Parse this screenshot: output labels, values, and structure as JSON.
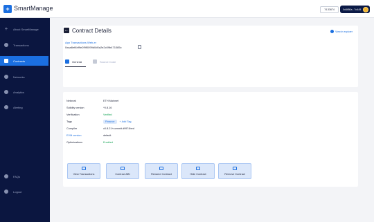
{
  "app": {
    "title": "SmartManage",
    "logo_icon": "plus-square-icon"
  },
  "header": {
    "balance": "74.33674",
    "wallet": "0x8480a...7cA45"
  },
  "sidebar": {
    "items": [
      {
        "label": "About SmartManage",
        "icon": "plus-icon"
      },
      {
        "label": "Transactions",
        "icon": "transactions-icon"
      },
      {
        "label": "Contracts",
        "icon": "contracts-icon",
        "active": true
      },
      {
        "label": "Networks",
        "icon": "networks-icon"
      },
      {
        "label": "Analytics",
        "icon": "analytics-icon"
      },
      {
        "label": "Alerting",
        "icon": "bell-icon"
      }
    ],
    "bottom": [
      {
        "label": "FAQs",
        "icon": "help-icon"
      },
      {
        "label": "Logout",
        "icon": "logout-icon"
      }
    ]
  },
  "page": {
    "title": "Contract Details",
    "explorer_link": "View in explorer",
    "address_label": "App Transactions Web-er",
    "address_value": "0xaa8ef4bf9e2f9f0099d0d0a2e2c09b471085c",
    "tabs": {
      "general": "General",
      "source": "Source Code"
    }
  },
  "details": {
    "rows": [
      {
        "key": "Network",
        "value": "ETH Mainnet",
        "style": ""
      },
      {
        "key": "Solidity version",
        "value": "^0.8.16",
        "style": ""
      },
      {
        "key": "Verification",
        "value": "Verified",
        "style": "green"
      },
      {
        "key": "Tags",
        "tag": "Finance",
        "add": "+ Add Tag"
      },
      {
        "key": "Compiler",
        "value": "v0.8.21+commit.d9974bed",
        "style": ""
      },
      {
        "key": "EVM version",
        "value": "default",
        "style": "",
        "key_style": "blue"
      },
      {
        "key": "Optimizations",
        "value": "Enabled",
        "style": "green"
      }
    ]
  },
  "actions": [
    {
      "label": "View Transactions",
      "icon": "list-icon"
    },
    {
      "label": "Contract ABI",
      "icon": "code-icon"
    },
    {
      "label": "Rename Contract",
      "icon": "pencil-icon"
    },
    {
      "label": "Hide Contract",
      "icon": "eye-off-icon"
    },
    {
      "label": "Remove Contract",
      "icon": "trash-icon"
    }
  ],
  "colors": {
    "sidebar": "#0b1640",
    "accent": "#1b6fe0",
    "success": "#18a558",
    "wallet": "#0b1a46"
  }
}
